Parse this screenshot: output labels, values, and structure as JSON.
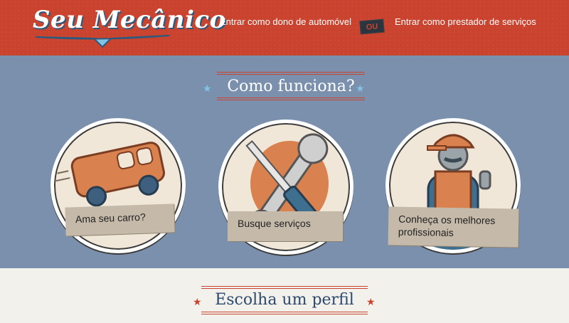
{
  "header": {
    "logo_text": "Seu Mecânico",
    "nav_owner": "Entrar como dono de automóvel",
    "or_badge": "OU",
    "nav_provider": "Entrar como prestador de serviços"
  },
  "how_it_works": {
    "title": "Como funciona?",
    "cards": [
      {
        "label": "Ama seu carro?",
        "icon": "car-icon"
      },
      {
        "label": "Busque serviços",
        "icon": "tools-icon"
      },
      {
        "label": "Conheça os melhores profissionais",
        "icon": "mechanic-icon"
      }
    ]
  },
  "profile": {
    "title": "Escolha um perfil"
  },
  "colors": {
    "header_red": "#c9432f",
    "section_blue": "#7b90ad",
    "cream": "#f0e7d8",
    "banner_tan": "#c5baaa",
    "navy": "#2c4a6d"
  }
}
